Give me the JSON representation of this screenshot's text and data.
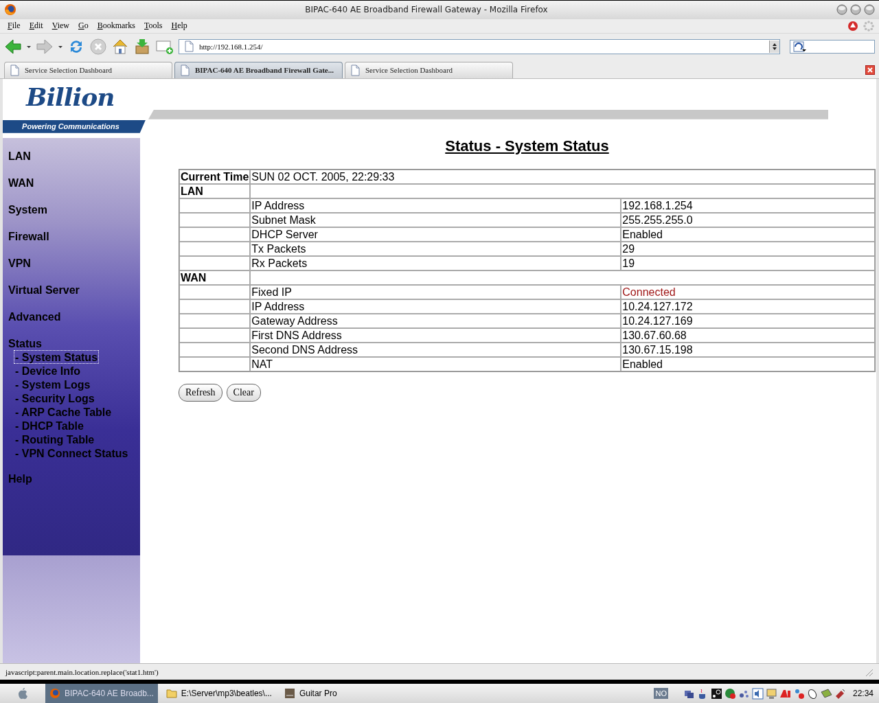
{
  "window": {
    "title": "BIPAC-640 AE Broadband Firewall Gateway - Mozilla Firefox"
  },
  "menu": [
    "File",
    "Edit",
    "View",
    "Go",
    "Bookmarks",
    "Tools",
    "Help"
  ],
  "address": {
    "value": "http://192.168.1.254/"
  },
  "tabs": [
    {
      "label": "Service Selection Dashboard",
      "selected": false
    },
    {
      "label": "BIPAC-640 AE Broadband Firewall Gate...",
      "selected": true
    },
    {
      "label": "Service Selection Dashboard",
      "selected": false
    }
  ],
  "logo": {
    "name": "Billion",
    "tagline": "Powering Communications"
  },
  "sidebar": {
    "items": [
      {
        "label": "LAN",
        "selected": false
      },
      {
        "label": "WAN",
        "selected": false
      },
      {
        "label": "System",
        "selected": false
      },
      {
        "label": "Firewall",
        "selected": false
      },
      {
        "label": "VPN",
        "selected": false
      },
      {
        "label": "Virtual Server",
        "selected": false
      },
      {
        "label": "Advanced",
        "selected": false
      },
      {
        "label": "Status",
        "selected": false,
        "children": [
          {
            "label": "- System Status",
            "selected": true
          },
          {
            "label": "- Device Info",
            "selected": false
          },
          {
            "label": "- System Logs",
            "selected": false
          },
          {
            "label": "- Security Logs",
            "selected": false
          },
          {
            "label": "- ARP Cache Table",
            "selected": false
          },
          {
            "label": "- DHCP Table",
            "selected": false
          },
          {
            "label": "- Routing Table",
            "selected": false
          },
          {
            "label": "- VPN Connect Status",
            "selected": false
          }
        ]
      },
      {
        "label": "Help",
        "selected": false
      }
    ]
  },
  "page": {
    "heading": "Status - System Status",
    "rows": [
      {
        "kind": "time",
        "label": "Current Time",
        "value": "SUN 02 OCT. 2005, 22:29:33"
      },
      {
        "kind": "section",
        "label": "LAN"
      },
      {
        "kind": "field",
        "label": "IP Address",
        "value": "192.168.1.254"
      },
      {
        "kind": "field",
        "label": "Subnet Mask",
        "value": "255.255.255.0"
      },
      {
        "kind": "field",
        "label": "DHCP Server",
        "value": "Enabled"
      },
      {
        "kind": "field",
        "label": "Tx Packets",
        "value": "29"
      },
      {
        "kind": "field",
        "label": "Rx Packets",
        "value": "19"
      },
      {
        "kind": "section",
        "label": "WAN"
      },
      {
        "kind": "field",
        "label": "Fixed IP",
        "value": "Connected",
        "color": "#a01818"
      },
      {
        "kind": "field",
        "label": "IP Address",
        "value": "10.24.127.172"
      },
      {
        "kind": "field",
        "label": "Gateway Address",
        "value": "10.24.127.169"
      },
      {
        "kind": "field",
        "label": "First DNS Address",
        "value": "130.67.60.68"
      },
      {
        "kind": "field",
        "label": "Second DNS Address",
        "value": "130.67.15.198"
      },
      {
        "kind": "field",
        "label": "NAT",
        "value": "Enabled"
      }
    ],
    "buttons": [
      "Refresh",
      "Clear"
    ]
  },
  "status_bar": {
    "text": "javascript:parent.main.location.replace('stat1.htm')"
  },
  "taskbar": {
    "tasks": [
      {
        "label": "BIPAC-640 AE Broadb...",
        "selected": true,
        "kind": "browser"
      },
      {
        "label": "E:\\Server\\mp3\\beatles\\...",
        "selected": false,
        "kind": "folder"
      },
      {
        "label": "Guitar Pro",
        "selected": false,
        "kind": "app"
      }
    ],
    "language": "NO",
    "clock": "22:34"
  }
}
